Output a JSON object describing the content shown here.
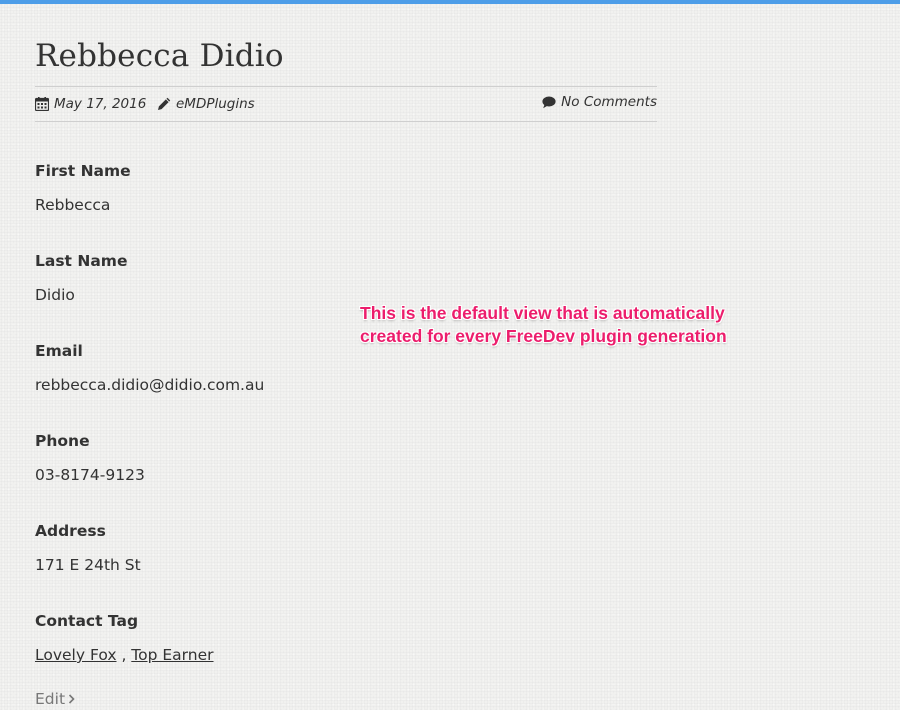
{
  "post": {
    "title": "Rebbecca Didio",
    "date": "May 17, 2016",
    "author": "eMDPlugins",
    "comments": "No Comments"
  },
  "fields": [
    {
      "label": "First Name",
      "value": "Rebbecca"
    },
    {
      "label": "Last Name",
      "value": "Didio"
    },
    {
      "label": "Email",
      "value": "rebbecca.didio@didio.com.au"
    },
    {
      "label": "Phone",
      "value": "03-8174-9123"
    },
    {
      "label": "Address",
      "value": "171 E 24th St"
    }
  ],
  "contact_tag": {
    "label": "Contact Tag",
    "tags": [
      "Lovely Fox",
      "Top Earner"
    ],
    "separator": " , "
  },
  "edit_label": "Edit",
  "annotation": {
    "line1": "This is the default view that is automatically",
    "line2": "created for every FreeDev plugin generation"
  },
  "colors": {
    "top_bar": "#4d9de8",
    "annotation": "#ec1d6c",
    "background": "#f1f1ef",
    "text": "#333333"
  },
  "icons": {
    "date": "calendar-icon",
    "author": "pencil-icon",
    "comments": "comment-icon",
    "edit": "chevron-right-icon"
  }
}
